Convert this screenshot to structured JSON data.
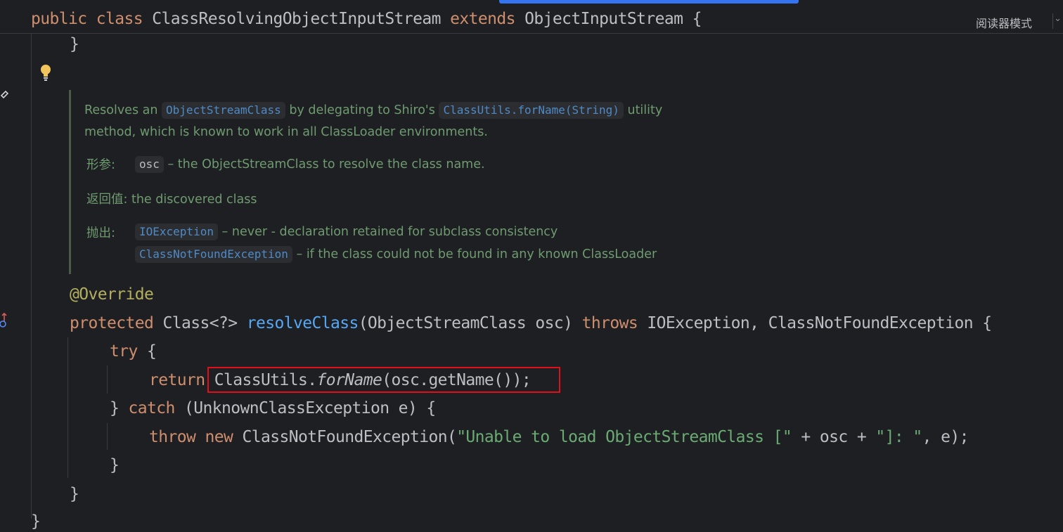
{
  "editor": {
    "sticky_header": {
      "kw_public": "public",
      "kw_class": "class",
      "class_name": "ClassResolvingObjectInputStream",
      "kw_extends": "extends",
      "super_name": "ObjectInputStream",
      "brace": "{"
    },
    "reader_mode_label": "阅读器模式",
    "reader_chevron": "⌄",
    "doc": {
      "line1_pre": "Resolves an",
      "line1_code1": "ObjectStreamClass",
      "line1_mid": "by delegating to Shiro's",
      "line1_code2": "ClassUtils.forName(String)",
      "line1_post": "utility",
      "line2": "method, which is known to work in all ClassLoader environments.",
      "params_label": "形参:",
      "param_name": "osc",
      "param_desc": "– the ObjectStreamClass to resolve the class name.",
      "returns_label": "返回值:",
      "returns_desc": "the discovered class",
      "throws_label": "抛出:",
      "throws1_code": "IOException",
      "throws1_desc": "– never - declaration retained for subclass consistency",
      "throws2_code": "ClassNotFoundException",
      "throws2_desc": "– if the class could not be found in any known ClassLoader"
    },
    "code": {
      "closing_brace_top": "}",
      "annotation": "@Override",
      "sig_protected": "protected",
      "sig_type": "Class<?>",
      "sig_method": "resolveClass",
      "sig_params": "(ObjectStreamClass osc)",
      "sig_throws": "throws",
      "sig_exceptions": "IOException, ClassNotFoundException {",
      "try_kw": "try",
      "try_brace": "{",
      "return_kw": "return",
      "return_cls": "ClassUtils.",
      "return_method": "forName",
      "return_args": "(osc.getName());",
      "catch_close": "}",
      "catch_kw": "catch",
      "catch_args": "(UnknownClassException e) {",
      "throw_kw": "throw",
      "new_kw": "new",
      "throw_cls": "ClassNotFoundException(",
      "throw_str1": "\"Unable to load ObjectStreamClass [\"",
      "throw_plus1": " + osc + ",
      "throw_str2": "\"]: \"",
      "throw_end": ", e);",
      "catch_end_brace": "}",
      "method_end_brace": "}",
      "class_end_brace": "}"
    }
  }
}
